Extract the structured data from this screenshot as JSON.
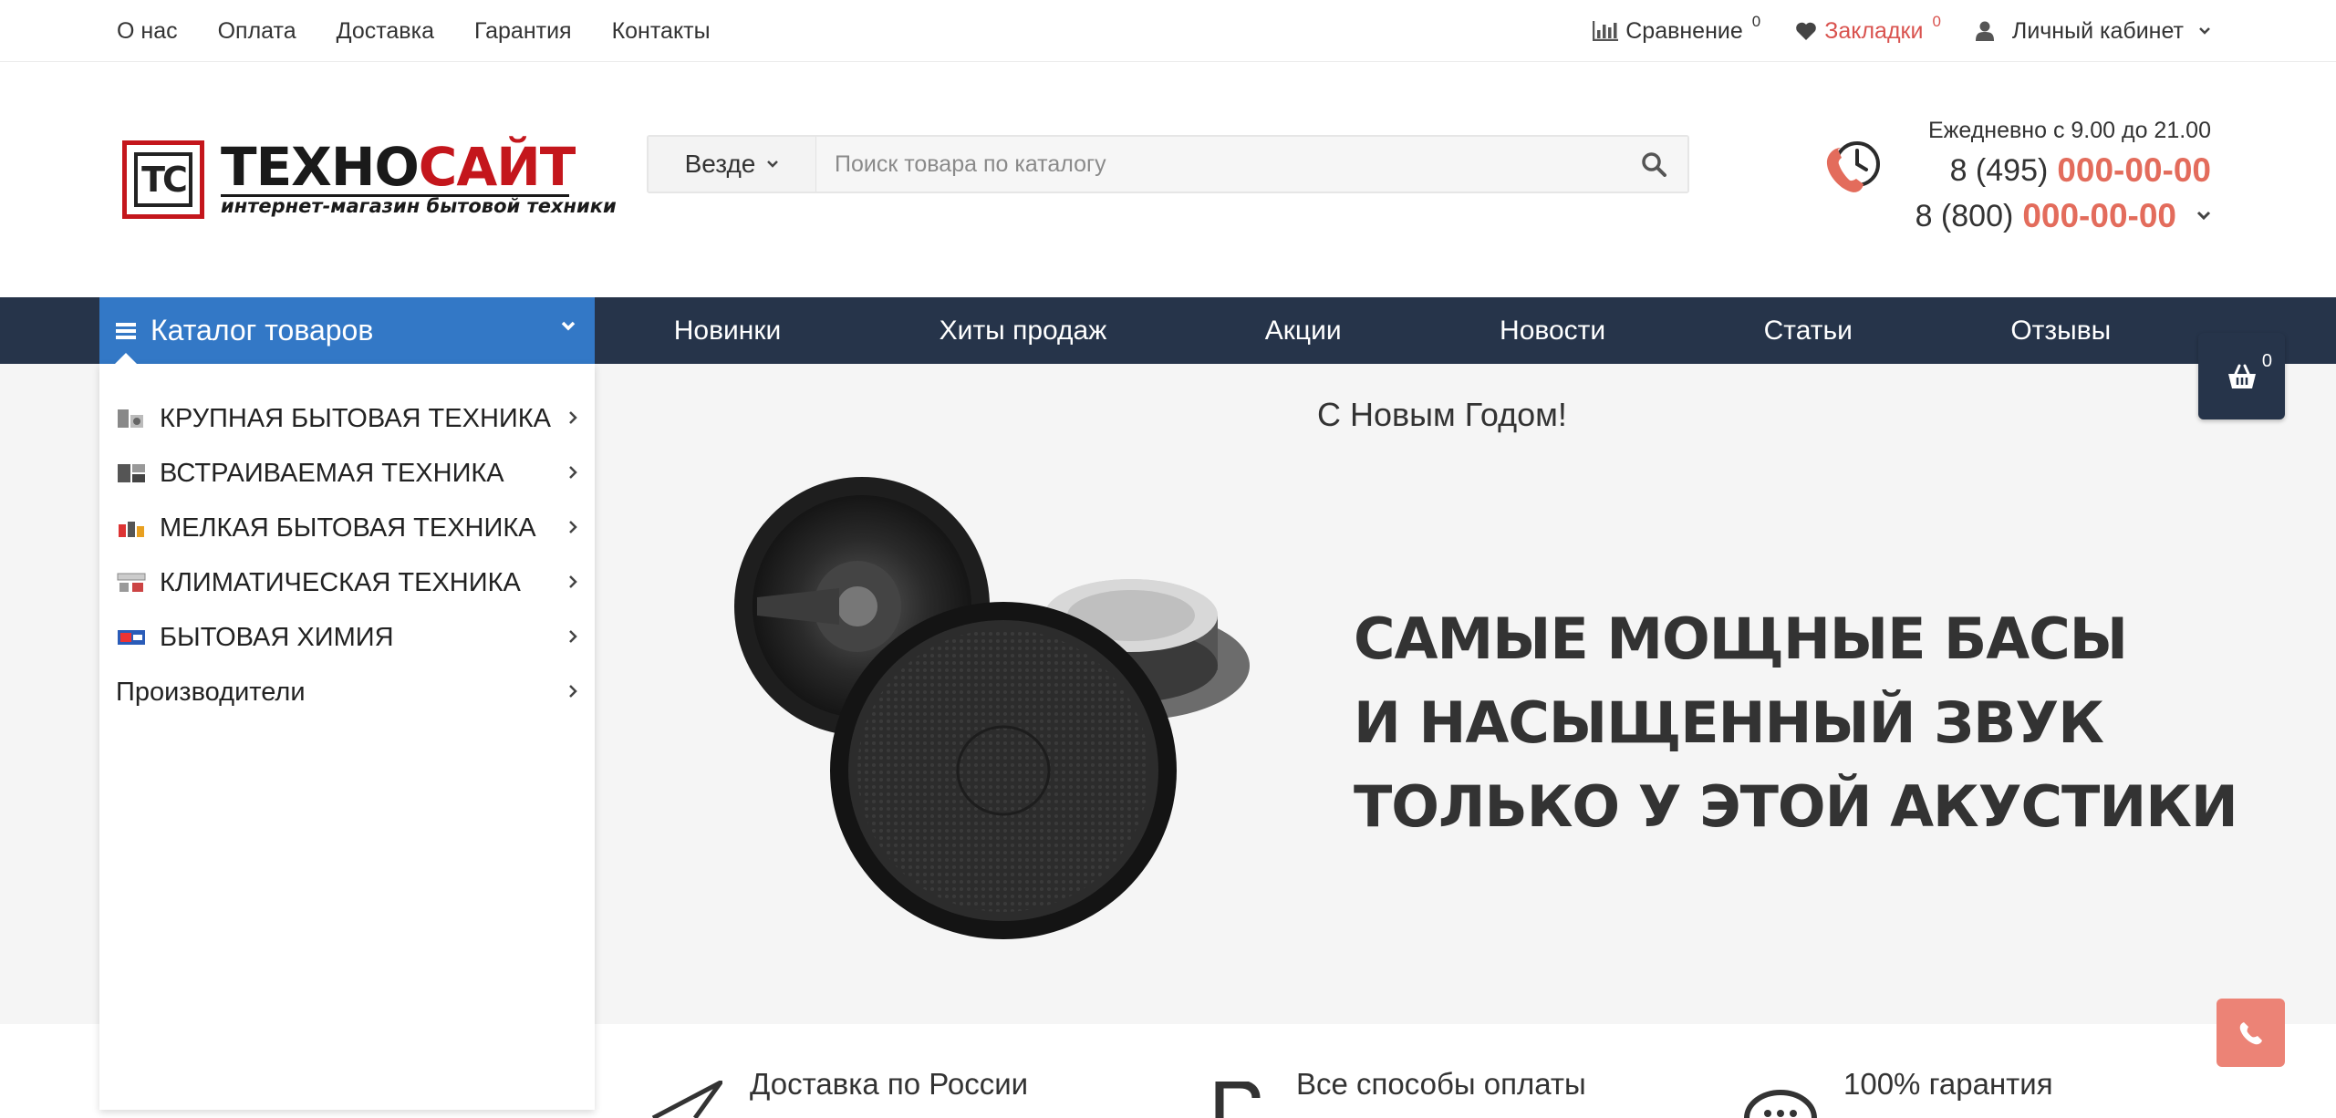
{
  "top_links": [
    "О нас",
    "Оплата",
    "Доставка",
    "Гарантия",
    "Контакты"
  ],
  "top_right": {
    "compare_label": "Сравнение",
    "compare_count": "0",
    "bookmarks_label": "Закладки",
    "bookmarks_count": "0",
    "account_label": "Личный кабинет"
  },
  "logo": {
    "mark": "TC",
    "title_part1": "ТЕХНО",
    "title_part2": "САЙТ",
    "subtitle": "интернет-магазин бытовой техники"
  },
  "search": {
    "scope": "Везде",
    "placeholder": "Поиск товара по каталогу"
  },
  "contacts": {
    "hours": "Ежедневно с 9.00 до 21.00",
    "phone1_prefix": "8 (495)",
    "phone1_number": "000-00-00",
    "phone2_prefix": "8 (800)",
    "phone2_number": "000-00-00"
  },
  "catalog": {
    "label": "Каталог товаров",
    "items": [
      {
        "label": "КРУПНАЯ БЫТОВАЯ ТЕХНИКА"
      },
      {
        "label": "ВСТРАИВАЕМАЯ ТЕХНИКА"
      },
      {
        "label": "МЕЛКАЯ БЫТОВАЯ ТЕХНИКА"
      },
      {
        "label": "КЛИМАТИЧЕСКАЯ ТЕХНИКА"
      },
      {
        "label": "БЫТОВАЯ ХИМИЯ"
      },
      {
        "label": "Производители"
      }
    ]
  },
  "nav": [
    "Новинки",
    "Хиты продаж",
    "Акции",
    "Новости",
    "Статьи",
    "Отзывы"
  ],
  "cart": {
    "count": "0"
  },
  "hero": {
    "greeting": "С Новым Годом!",
    "line1": "САМЫЕ МОЩНЫЕ БАСЫ",
    "line2": "И НАСЫЩЕННЫЙ ЗВУК",
    "line3": "ТОЛЬКО У ЭТОЙ АКУСТИКИ"
  },
  "features": [
    {
      "label": "Доставка по России",
      "icon": "paper-plane-icon"
    },
    {
      "label": "Все способы оплаты",
      "icon": "ruble-icon"
    },
    {
      "label": "100% гарантия",
      "icon": "chat-icon"
    }
  ],
  "colors": {
    "nav_bg": "#26344a",
    "catalog_bg": "#3378c6",
    "accent_red": "#e36c5c",
    "call_button": "#ec8376"
  }
}
